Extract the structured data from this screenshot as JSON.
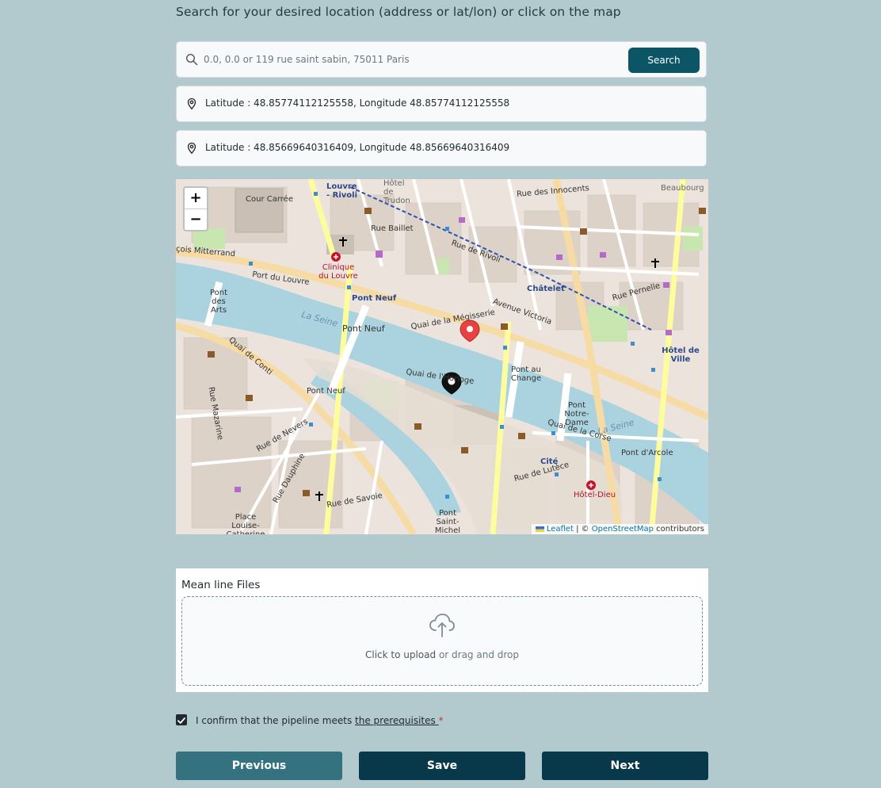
{
  "heading": "Search for your desired location (address or lat/lon) or click on the map",
  "search": {
    "placeholder": "0.0, 0.0 or 119 rue saint sabin, 75011 Paris",
    "button_label": "Search"
  },
  "locations": [
    {
      "text": "Latitude : 48.85774112125558, Longitude 48.85774112125558"
    },
    {
      "text": "Latitude : 48.85669640316409, Longitude 48.85669640316409"
    }
  ],
  "map": {
    "zoom_in": "+",
    "zoom_out": "−",
    "attribution": {
      "leaflet": "Leaflet",
      "sep": " | © ",
      "osm": "OpenStreetMap",
      "suffix": " contributors"
    },
    "labels": {
      "cour_carree": "Cour Carrée",
      "louvre_rivoli": "Louvre - Rivoli",
      "hotel_trudon": "Hôtel de Trudon",
      "clinique_louvre": "Clinique du Louvre",
      "rue_baillet": "Rue Baillet",
      "pont_neuf_1": "Pont Neuf",
      "pont_neuf_2": "Pont Neuf",
      "pont_neuf_3": "Pont Neuf",
      "quai_megisserie": "Quai de la Mégisserie",
      "chatelet": "Châtelet",
      "avenue_victoria": "Avenue Victoria",
      "hotel_de_ville": "Hôtel de Ville",
      "pont_des_arts": "Pont des Arts",
      "la_seine_1": "La Seine",
      "la_seine_2": "La Seine",
      "quai_conti": "Quai de Conti",
      "pont_au_change": "Pont au Change",
      "pont_notre_dame": "Pont Notre-Dame",
      "cite": "Cité",
      "hotel_dieu": "Hôtel-Dieu",
      "pont_arcole": "Pont d'Arcole",
      "pont_saint_michel": "Pont Saint-Michel",
      "place_louise": "Place Louise-Catherine Breslau",
      "beaubourg": "Beaubourg",
      "rue_de_rivoli": "Rue de Rivoli",
      "rue_pernelle": "Rue Pernelle",
      "quai_horloge": "Quai de l'Horloge",
      "rue_de_lutece": "Rue de Lutèce",
      "rue_des_innocents": "Rue des Innocents",
      "cois_mitterrand": "çois Mitterrand",
      "port_du_louvre": "Port du Louvre",
      "rue_de_nevers": "Rue de Nevers",
      "rue_mazarine": "Rue Mazarine",
      "rue_de_savoie": "Rue de Savoie",
      "rue_dauphine": "Rue Dauphine",
      "quai_corse": "Quai de la Corse"
    }
  },
  "upload": {
    "title": "Mean line Files",
    "click_text": "Click to upload",
    "rest_text": " or drag and drop"
  },
  "confirm": {
    "prefix": "I confirm that the pipeline meets ",
    "link": "the prerequisites ",
    "required": "*",
    "checked": true
  },
  "buttons": {
    "previous": "Previous",
    "save": "Save",
    "next": "Next"
  },
  "colors": {
    "background": "#b2c9ce",
    "primary": "#08394a",
    "secondary": "#357280",
    "search_button": "#0b5566",
    "marker_red": "#e84141",
    "marker_black": "#111111"
  }
}
